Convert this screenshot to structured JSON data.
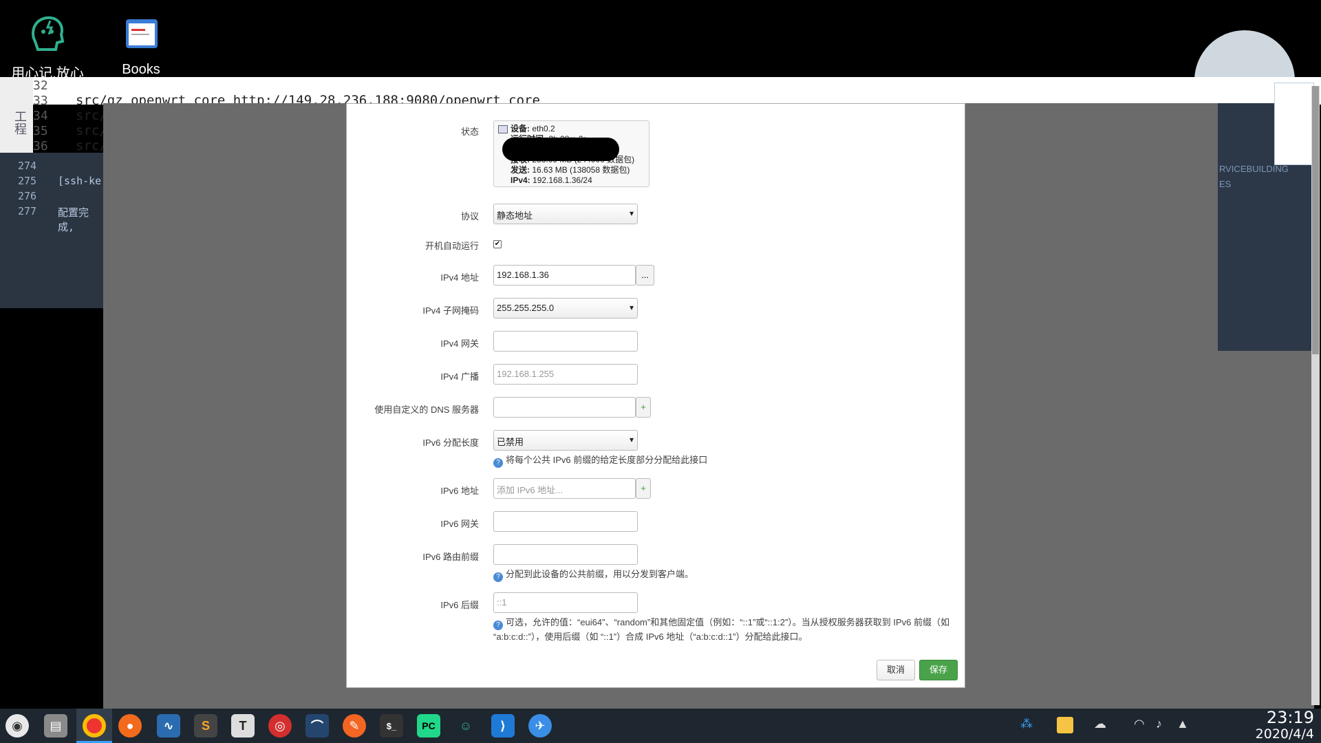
{
  "desktop": {
    "icons": [
      {
        "label": "用心记,放心",
        "icon": "brain-note-icon"
      },
      {
        "label": "Books",
        "icon": "book-icon"
      }
    ]
  },
  "editor": {
    "line_numbers": [
      "32",
      "33",
      "34",
      "35",
      "36"
    ],
    "code_line_33": "src/gz openwrt core http://149.28.236.188:9080/openwrt core",
    "code_prefix": "src/",
    "dark_numbers": [
      "274",
      "275",
      "276",
      "277"
    ],
    "dark_lines": [
      "[ssh-ke",
      "配置完成,"
    ],
    "sidebar_text": "工程"
  },
  "background_page": {
    "right_text_1": "RVICEBUILDING",
    "right_text_2": "ES"
  },
  "modal": {
    "status": {
      "label": "状态",
      "device_label": "设备:",
      "device_value": "eth0.2",
      "uptime_label": "运行时间:",
      "uptime_value": "2h 28m 2s",
      "rx_label": "接收:",
      "rx_value": "288.09 MB (244900 数据包)",
      "tx_label": "发送:",
      "tx_value": "16.63 MB (138058 数据包)",
      "ipv4_label": "IPv4:",
      "ipv4_value": "192.168.1.36/24"
    },
    "protocol": {
      "label": "协议",
      "value": "静态地址"
    },
    "autostart": {
      "label": "开机自动运行",
      "checked": true
    },
    "ipv4_addr": {
      "label": "IPv4 地址",
      "value": "192.168.1.36",
      "addon": "..."
    },
    "ipv4_mask": {
      "label": "IPv4 子网掩码",
      "value": "255.255.255.0"
    },
    "ipv4_gw": {
      "label": "IPv4 网关",
      "value": ""
    },
    "ipv4_bcast": {
      "label": "IPv4 广播",
      "placeholder": "192.168.1.255"
    },
    "dns": {
      "label": "使用自定义的 DNS 服务器",
      "value": "",
      "addon": "+"
    },
    "ipv6_assign": {
      "label": "IPv6 分配长度",
      "value": "已禁用",
      "hint": "将每个公共 IPv6 前缀的给定长度部分分配给此接口"
    },
    "ipv6_addr": {
      "label": "IPv6 地址",
      "placeholder": "添加 IPv6 地址...",
      "addon": "+"
    },
    "ipv6_gw": {
      "label": "IPv6 网关",
      "value": ""
    },
    "ipv6_prefix": {
      "label": "IPv6 路由前缀",
      "value": "",
      "hint": "分配到此设备的公共前缀，用以分发到客户端。"
    },
    "ipv6_suffix": {
      "label": "IPv6 后缀",
      "placeholder": "::1",
      "hint_line1": "可选，允许的值：“eui64”、“random”和其他固定值（例如：“::1”或“::1:2”）。当从授权服务器获取到 IPv6 前缀（如",
      "hint_line2": "“a:b:c:d::”），使用后缀（如 “::1”）合成 IPv6 地址（“a:b:c:d::1”）分配给此接口。"
    },
    "buttons": {
      "cancel": "取消",
      "save": "保存"
    }
  },
  "taskbar": {
    "apps": [
      "launcher-icon",
      "files-icon",
      "chrome-icon",
      "firefox-icon",
      "monitor-icon",
      "sublime-icon",
      "typora-icon",
      "netease-music-icon",
      "mysql-workbench-icon",
      "pen-icon",
      "terminal-icon",
      "pycharm-icon",
      "brain-note-icon",
      "vscode-icon",
      "feishu-icon"
    ],
    "tray": [
      "share-icon",
      "sticky-notes-icon",
      "cloud-icon",
      "wifi-icon",
      "volume-icon",
      "tray-expand-icon"
    ],
    "time": "23:19",
    "date": "2020/4/4"
  }
}
